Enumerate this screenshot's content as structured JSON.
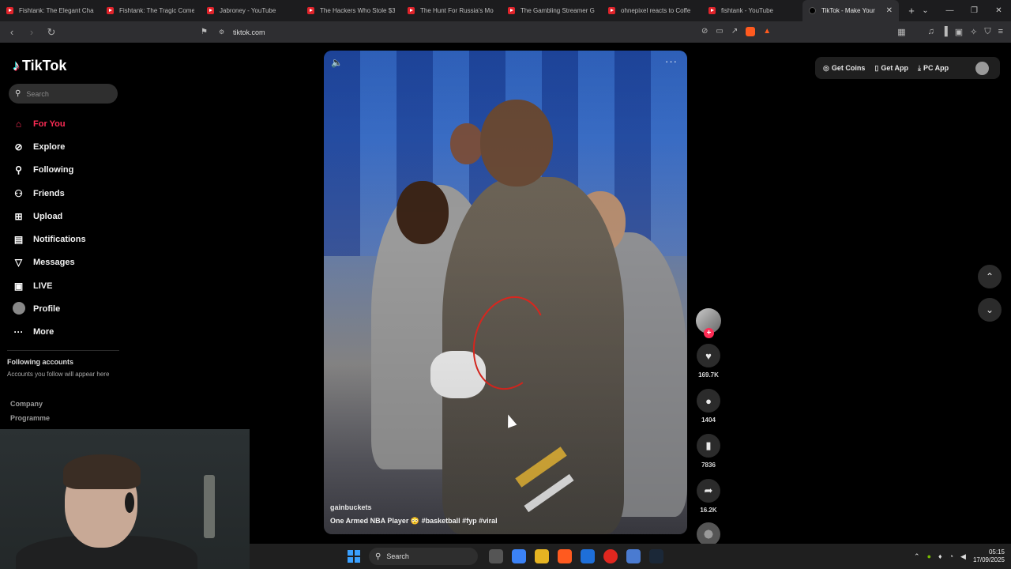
{
  "browser": {
    "tabs": [
      {
        "title": "Fishtank: The Elegant Chaos",
        "active": false
      },
      {
        "title": "Fishtank: The Tragic Comedy",
        "active": false
      },
      {
        "title": "Jabroney - YouTube",
        "active": false
      },
      {
        "title": "The Hackers Who Stole $3",
        "active": false
      },
      {
        "title": "The Hunt For Russia's Mo",
        "active": false
      },
      {
        "title": "The Gambling Streamer G",
        "active": false
      },
      {
        "title": "ohnepixel reacts to Coffe",
        "active": false
      },
      {
        "title": "fishtank - YouTube",
        "active": false
      },
      {
        "title": "TikTok - Make Your",
        "active": true
      }
    ],
    "new_tab": "+",
    "url": "tiktok.com"
  },
  "tiktok": {
    "logo": "TikTok",
    "search_placeholder": "Search",
    "nav": [
      {
        "label": "For You",
        "icon": "home-icon",
        "glyph": "⌂",
        "active": true
      },
      {
        "label": "Explore",
        "icon": "compass-icon",
        "glyph": "⊘",
        "active": false
      },
      {
        "label": "Following",
        "icon": "person-icon",
        "glyph": "⚲",
        "active": false
      },
      {
        "label": "Friends",
        "icon": "friends-icon",
        "glyph": "⚇",
        "active": false
      },
      {
        "label": "Upload",
        "icon": "upload-icon",
        "glyph": "⊞",
        "active": false
      },
      {
        "label": "Notifications",
        "icon": "inbox-icon",
        "glyph": "▤",
        "active": false
      },
      {
        "label": "Messages",
        "icon": "send-icon",
        "glyph": "▽",
        "active": false
      },
      {
        "label": "LIVE",
        "icon": "live-icon",
        "glyph": "▣",
        "active": false
      },
      {
        "label": "Profile",
        "icon": "avatar-icon",
        "glyph": "",
        "active": false
      },
      {
        "label": "More",
        "icon": "more-icon",
        "glyph": "···",
        "active": false
      }
    ],
    "following_accounts_title": "Following accounts",
    "following_accounts_sub": "Accounts you follow will appear here",
    "footer_links": [
      "Company",
      "Programme"
    ],
    "topbar": {
      "get_coins": "Get Coins",
      "get_app": "Get App",
      "pc_app": "PC App"
    },
    "video": {
      "username": "gainbuckets",
      "caption": "One Armed NBA Player 😳 #basketball #fyp #viral"
    },
    "actions": {
      "likes": "169.7K",
      "comments": "1404",
      "saves": "7836",
      "shares": "16.2K"
    }
  },
  "taskbar": {
    "search_placeholder": "Search",
    "time": "05:15",
    "date": "17/09/2025"
  },
  "colors": {
    "accent": "#fe2c55",
    "background": "#000000",
    "panel": "#2b2b2b"
  }
}
